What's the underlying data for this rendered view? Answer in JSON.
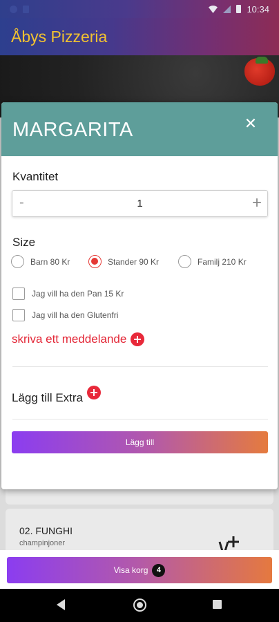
{
  "status_bar": {
    "time": "10:34"
  },
  "app": {
    "title": "Åbys Pizzeria"
  },
  "background_menu": {
    "item_title": "02. FUNGHI",
    "item_subtitle": "champinjoner"
  },
  "modal": {
    "title": "MARGARITA",
    "quantity": {
      "label": "Kvantitet",
      "minus": "-",
      "value": "1",
      "plus": "+"
    },
    "size": {
      "label": "Size",
      "options": [
        {
          "label": "Barn 80 Kr",
          "selected": false
        },
        {
          "label": "Stander 90 Kr",
          "selected": true
        },
        {
          "label": "Familj 210 Kr",
          "selected": false
        }
      ]
    },
    "options": [
      {
        "label": "Jag vill ha den Pan 15 Kr",
        "checked": false
      },
      {
        "label": "Jag vill ha den Glutenfri",
        "checked": false
      }
    ],
    "message_link": "skriva ett meddelande",
    "extra_label": "Lägg till Extra",
    "add_button": "Lägg till",
    "accent_color": "#e32636",
    "header_color": "#5e9e9a"
  },
  "bottom": {
    "cart_button": "Visa korg",
    "cart_count": "4"
  }
}
